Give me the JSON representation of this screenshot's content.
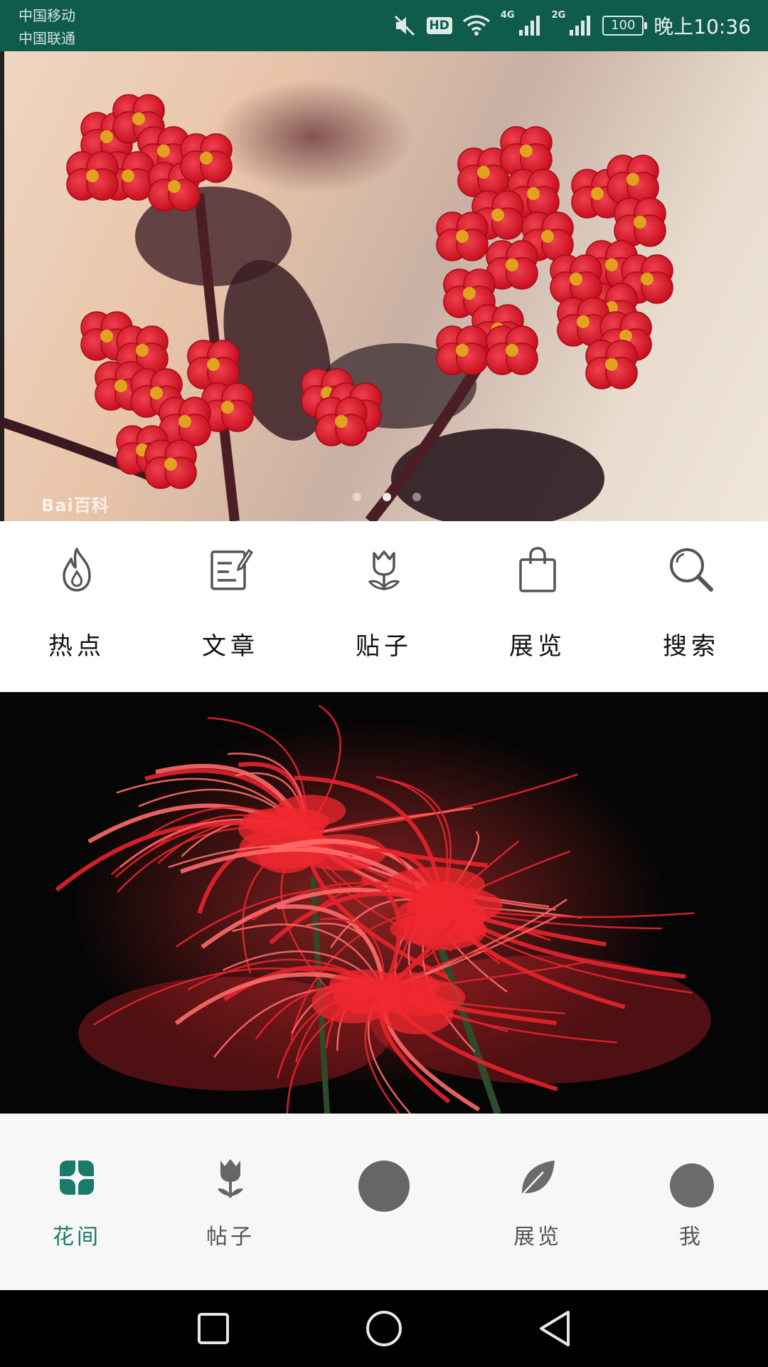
{
  "status_bar": {
    "carrier_1": "中国移动",
    "carrier_2": "中国联通",
    "hd_badge": "HD",
    "net_4g": "4G",
    "net_2g": "2G",
    "battery": "100",
    "time": "晚上10:36",
    "icons": [
      "mute-icon",
      "hd-icon",
      "wifi-icon",
      "signal-4g-icon",
      "signal-2g-icon",
      "battery-icon"
    ],
    "background_color": "#0f5c4d"
  },
  "banner": {
    "watermark": "Bai百科",
    "page_count": 3,
    "active_index": 0
  },
  "categories": [
    {
      "label": "热点",
      "icon": "flame-icon"
    },
    {
      "label": "文章",
      "icon": "edit-note-icon"
    },
    {
      "label": "贴子",
      "icon": "tulip-icon"
    },
    {
      "label": "展览",
      "icon": "shopping-bag-icon"
    },
    {
      "label": "搜索",
      "icon": "search-icon"
    }
  ],
  "tabbar": {
    "accent_color": "#1a7a6c",
    "items": [
      {
        "label": "花间",
        "icon": "clover-icon",
        "active": true
      },
      {
        "label": "帖子",
        "icon": "tulip-icon",
        "active": false
      },
      {
        "label": "",
        "icon": "circle-icon",
        "active": false
      },
      {
        "label": "展览",
        "icon": "leaf-icon",
        "active": false
      },
      {
        "label": "我",
        "icon": "avatar-circle-icon",
        "active": false
      }
    ]
  },
  "navbar": {
    "icons": [
      "recent-apps-icon",
      "home-icon",
      "back-icon"
    ]
  }
}
